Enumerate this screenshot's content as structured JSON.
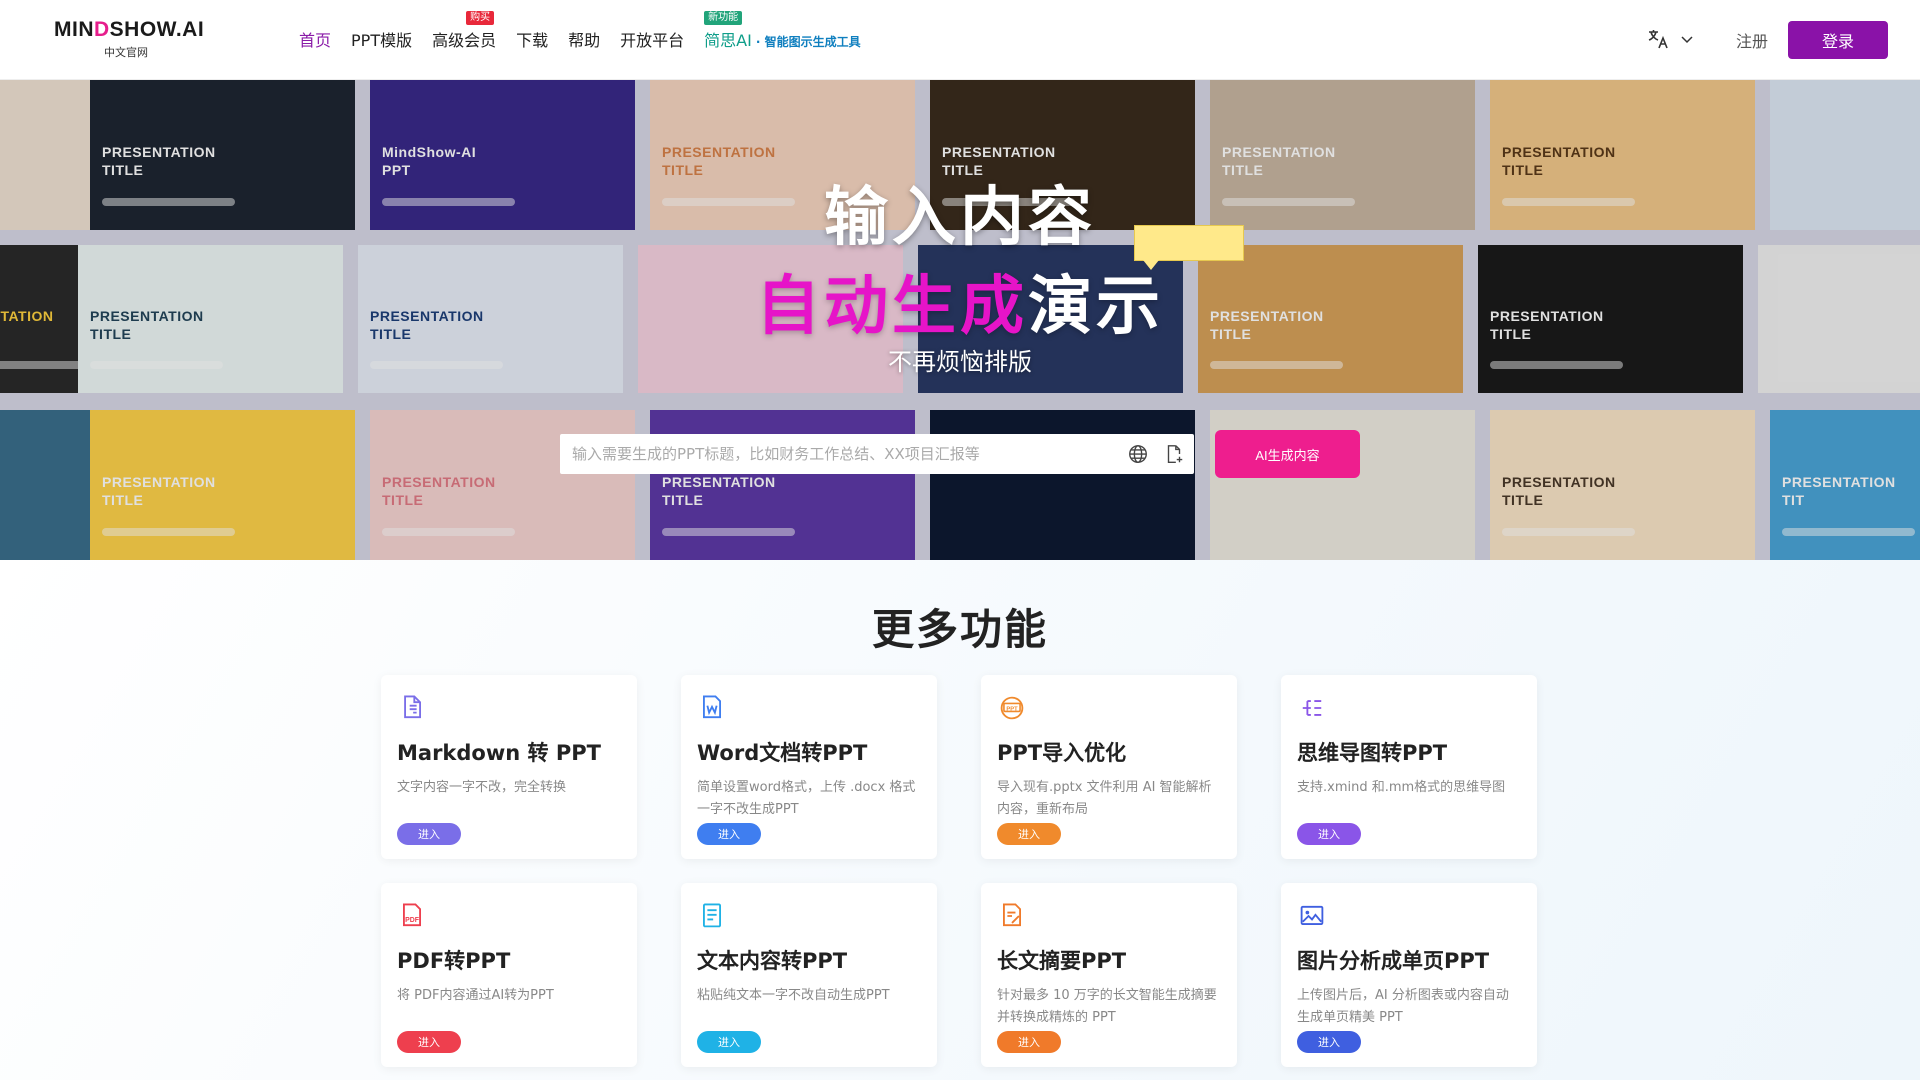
{
  "brand": {
    "logo_prefix": "MIN",
    "logo_accent": "D",
    "logo_suffix": "SHOW.AI",
    "logo_sub": "中文官网",
    "accent_color": "#e61e8c",
    "primary_color": "#8a12a8"
  },
  "nav": {
    "home": "首页",
    "templates": "PPT模版",
    "vip": "高级会员",
    "vip_badge": "购买",
    "download": "下载",
    "help": "帮助",
    "open_platform": "开放平台",
    "jiansi": "简思AI",
    "jiansi_badge": "新功能",
    "jiansi_sub": "· 智能图示生成工具"
  },
  "auth": {
    "register": "注册",
    "login": "登录"
  },
  "hero": {
    "title_line1": "输入内容",
    "title_line2_pink": "自动生成",
    "title_line2_white": "演示",
    "subtitle": "不再烦恼排版",
    "search_placeholder": "输入需要生成的PPT标题，比如财务工作总结、XX项目汇报等",
    "generate_button": "AI生成内容",
    "tiles": [
      {
        "text": "",
        "color": "#f1e3d4",
        "fg": "#333"
      },
      {
        "text": "PRESENTATION TITLE",
        "color": "#1e2633",
        "fg": "#ffffff"
      },
      {
        "text": "MindShow-AI PPT",
        "color": "#3a2a8a",
        "fg": "#ffffff"
      },
      {
        "text": "PRESENTATION TITLE",
        "color": "#f7d7c2",
        "fg": "#d9824a"
      },
      {
        "text": "PRESENTATION TITLE",
        "color": "#3b2c1d",
        "fg": "#ffffff"
      },
      {
        "text": "PRESENTATION TITLE",
        "color": "#c9b7a2",
        "fg": "#ffffff"
      },
      {
        "text": "PRESENTATION TITLE",
        "color": "#f3c98b",
        "fg": "#5a3a1a"
      },
      {
        "text": "",
        "color": "#dfe9f5",
        "fg": "#333"
      },
      {
        "text": "ENTATION",
        "color": "#2b2b2b",
        "fg": "#ffd23f"
      },
      {
        "text": "PRESENTATION TITLE",
        "color": "#eef8f6",
        "fg": "#23455a"
      },
      {
        "text": "PRESENTATION TITLE",
        "color": "#e9eef9",
        "fg": "#1d3f7a"
      },
      {
        "text": "",
        "color": "#f8d3e2",
        "fg": "#333"
      },
      {
        "text": "",
        "color": "#2a3a66",
        "fg": "#fff"
      },
      {
        "text": "PRESENTATION TITLE",
        "color": "#d8a25a",
        "fg": "#ffffff"
      },
      {
        "text": "PRESENTATION TITLE",
        "color": "#1b1b1b",
        "fg": "#ffffff"
      },
      {
        "text": "",
        "color": "#f1f1f1",
        "fg": "#333"
      },
      {
        "text": "",
        "color": "#3b6f8c",
        "fg": "#fff"
      },
      {
        "text": "PRESENTATION TITLE",
        "color": "#ffd34a",
        "fg": "#ffffff"
      },
      {
        "text": "PRESENTATION TITLE",
        "color": "#f7d5d3",
        "fg": "#e37a86"
      },
      {
        "text": "PRESENTATION TITLE",
        "color": "#5e3aa8",
        "fg": "#ffffff"
      },
      {
        "text": "",
        "color": "#0e1a33",
        "fg": "#fff"
      },
      {
        "text": "",
        "color": "#f0ece2",
        "fg": "#333"
      },
      {
        "text": "PRESENTATION TITLE",
        "color": "#fbe6c9",
        "fg": "#4a3a2a"
      },
      {
        "text": "PRESENTATION TIT",
        "color": "#4aa6d9",
        "fg": "#ffffff"
      }
    ]
  },
  "features": {
    "title": "更多功能",
    "cards": [
      {
        "title": "Markdown 转 PPT",
        "desc": "文字内容一字不改，完全转换",
        "button": "进入",
        "color": "#7a6ee8",
        "icon": "markdown-file-icon"
      },
      {
        "title": "Word文档转PPT",
        "desc": "简单设置word格式，上传 .docx 格式一字不改生成PPT",
        "button": "进入",
        "color": "#3f7ef0",
        "icon": "word-file-icon"
      },
      {
        "title": "PPT导入优化",
        "desc": "导入现有.pptx 文件利用 AI 智能解析内容，重新布局",
        "button": "进入",
        "color": "#f08a2c",
        "icon": "ppt-file-icon"
      },
      {
        "title": "思维导图转PPT",
        "desc": "支持.xmind 和.mm格式的思维导图",
        "button": "进入",
        "color": "#8a55e8",
        "icon": "mindmap-icon"
      },
      {
        "title": "PDF转PPT",
        "desc": "将 PDF内容通过AI转为PPT",
        "button": "进入",
        "color": "#ee3f4e",
        "icon": "pdf-file-icon"
      },
      {
        "title": "文本内容转PPT",
        "desc": "粘贴纯文本一字不改自动生成PPT",
        "button": "进入",
        "color": "#1fb2e6",
        "icon": "text-file-icon"
      },
      {
        "title": "长文摘要PPT",
        "desc": "针对最多 10 万字的长文智能生成摘要并转换成精炼的 PPT",
        "button": "进入",
        "color": "#f07a2a",
        "icon": "summary-edit-icon"
      },
      {
        "title": "图片分析成单页PPT",
        "desc": "上传图片后，AI 分析图表或内容自动生成单页精美 PPT",
        "button": "进入",
        "color": "#3f5fe0",
        "icon": "image-icon"
      }
    ]
  }
}
